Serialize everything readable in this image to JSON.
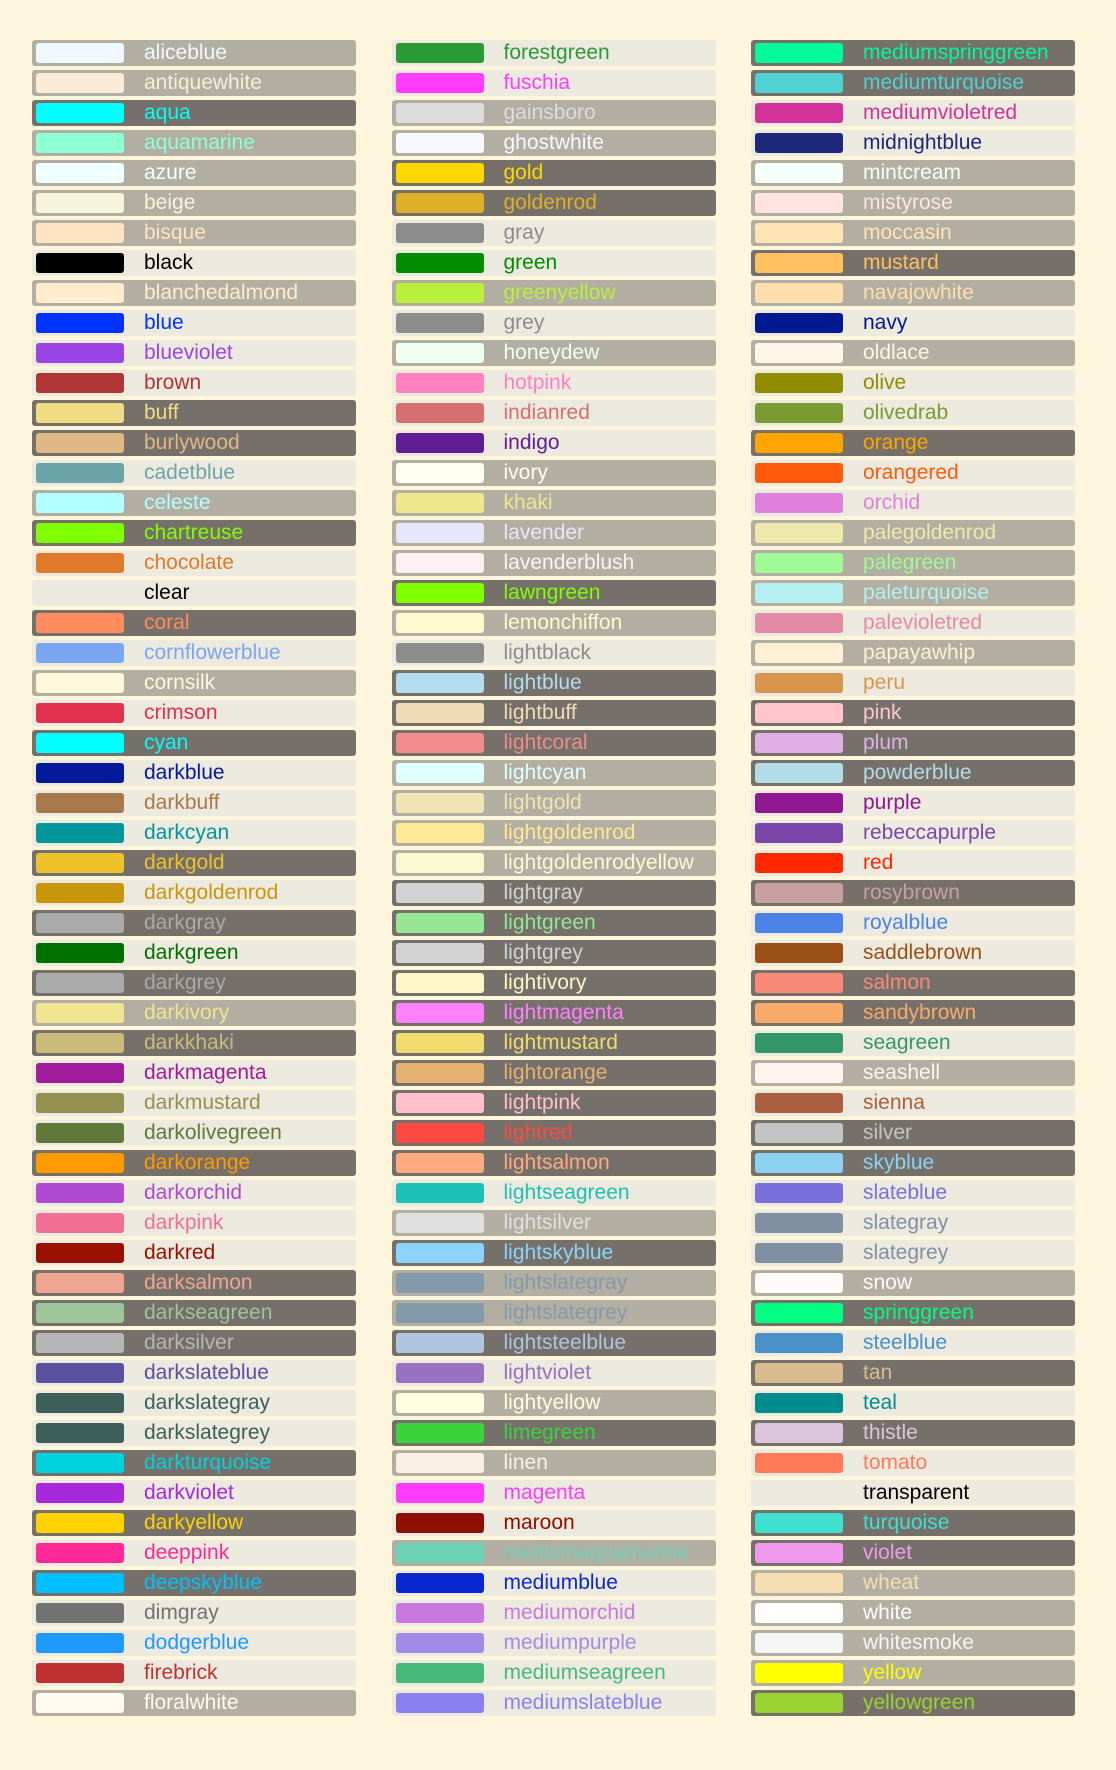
{
  "colors": [
    [
      {
        "name": "aliceblue",
        "hex": "#f0f8ff",
        "bg": "m"
      },
      {
        "name": "antiquewhite",
        "hex": "#faebd7",
        "bg": "m"
      },
      {
        "name": "aqua",
        "hex": "#00ffff",
        "bg": "d"
      },
      {
        "name": "aquamarine",
        "hex": "#8fffd4",
        "bg": "m"
      },
      {
        "name": "azure",
        "hex": "#f0ffff",
        "bg": "m"
      },
      {
        "name": "beige",
        "hex": "#f5f5dc",
        "bg": "m"
      },
      {
        "name": "bisque",
        "hex": "#ffe4c4",
        "bg": "m"
      },
      {
        "name": "black",
        "hex": "#000000",
        "bg": "l"
      },
      {
        "name": "blanchedalmond",
        "hex": "#ffebcd",
        "bg": "m"
      },
      {
        "name": "blue",
        "hex": "#0033ff",
        "bg": "l"
      },
      {
        "name": "blueviolet",
        "hex": "#9a45e6",
        "bg": "l"
      },
      {
        "name": "brown",
        "hex": "#b03535",
        "bg": "l"
      },
      {
        "name": "buff",
        "hex": "#f0dc82",
        "bg": "d"
      },
      {
        "name": "burlywood",
        "hex": "#deb887",
        "bg": "d"
      },
      {
        "name": "cadetblue",
        "hex": "#6ba5aa",
        "bg": "l"
      },
      {
        "name": "celeste",
        "hex": "#b2ffff",
        "bg": "m"
      },
      {
        "name": "chartreuse",
        "hex": "#80ff00",
        "bg": "d"
      },
      {
        "name": "chocolate",
        "hex": "#df7a2a",
        "bg": "l"
      },
      {
        "name": "clear",
        "hex": "transparent",
        "bg": "l",
        "text": "#000000"
      },
      {
        "name": "coral",
        "hex": "#ff8c5e",
        "bg": "d"
      },
      {
        "name": "cornflowerblue",
        "hex": "#7aa5f0",
        "bg": "l"
      },
      {
        "name": "cornsilk",
        "hex": "#fff8dc",
        "bg": "m"
      },
      {
        "name": "crimson",
        "hex": "#e2304f",
        "bg": "l"
      },
      {
        "name": "cyan",
        "hex": "#00ffff",
        "bg": "d"
      },
      {
        "name": "darkblue",
        "hex": "#041a9a",
        "bg": "l"
      },
      {
        "name": "darkbuff",
        "hex": "#a6784a",
        "bg": "l"
      },
      {
        "name": "darkcyan",
        "hex": "#00969a",
        "bg": "l"
      },
      {
        "name": "darkgold",
        "hex": "#eec22a",
        "bg": "d"
      },
      {
        "name": "darkgoldenrod",
        "hex": "#c8960a",
        "bg": "l"
      },
      {
        "name": "darkgray",
        "hex": "#aaaaaa",
        "bg": "d"
      },
      {
        "name": "darkgreen",
        "hex": "#007000",
        "bg": "l"
      },
      {
        "name": "darkgrey",
        "hex": "#aaaaaa",
        "bg": "d"
      },
      {
        "name": "darkivory",
        "hex": "#f0e490",
        "bg": "m"
      },
      {
        "name": "darkkhaki",
        "hex": "#c9bc7a",
        "bg": "d"
      },
      {
        "name": "darkmagenta",
        "hex": "#a01c9a",
        "bg": "l"
      },
      {
        "name": "darkmustard",
        "hex": "#939050",
        "bg": "l"
      },
      {
        "name": "darkolivegreen",
        "hex": "#60793a",
        "bg": "l"
      },
      {
        "name": "darkorange",
        "hex": "#ff9a00",
        "bg": "d"
      },
      {
        "name": "darkorchid",
        "hex": "#b04ad3",
        "bg": "l"
      },
      {
        "name": "darkpink",
        "hex": "#f07096",
        "bg": "l"
      },
      {
        "name": "darkred",
        "hex": "#9a1000",
        "bg": "l"
      },
      {
        "name": "darksalmon",
        "hex": "#eea690",
        "bg": "d"
      },
      {
        "name": "darkseagreen",
        "hex": "#9ec49a",
        "bg": "d"
      },
      {
        "name": "darksilver",
        "hex": "#b6b6b6",
        "bg": "d"
      },
      {
        "name": "darkslateblue",
        "hex": "#5a52a0",
        "bg": "l"
      },
      {
        "name": "darkslategray",
        "hex": "#3c5f5a",
        "bg": "l"
      },
      {
        "name": "darkslategrey",
        "hex": "#3c5f5a",
        "bg": "l"
      },
      {
        "name": "darkturquoise",
        "hex": "#00d2de",
        "bg": "d"
      },
      {
        "name": "darkviolet",
        "hex": "#a828dc",
        "bg": "l"
      },
      {
        "name": "darkyellow",
        "hex": "#ffd200",
        "bg": "d"
      },
      {
        "name": "deeppink",
        "hex": "#ff2896",
        "bg": "l"
      },
      {
        "name": "deepskyblue",
        "hex": "#00c0ff",
        "bg": "d"
      },
      {
        "name": "dimgray",
        "hex": "#727272",
        "bg": "l"
      },
      {
        "name": "dodgerblue",
        "hex": "#1e9aff",
        "bg": "l"
      },
      {
        "name": "firebrick",
        "hex": "#c03232",
        "bg": "l"
      },
      {
        "name": "floralwhite",
        "hex": "#fffaf0",
        "bg": "m"
      }
    ],
    [
      {
        "name": "forestgreen",
        "hex": "#2a9a36",
        "bg": "l"
      },
      {
        "name": "fuschia",
        "hex": "#ff3cff",
        "bg": "l"
      },
      {
        "name": "gainsboro",
        "hex": "#dcdcdc",
        "bg": "m"
      },
      {
        "name": "ghostwhite",
        "hex": "#f8f8ff",
        "bg": "m"
      },
      {
        "name": "gold",
        "hex": "#ffd700",
        "bg": "d"
      },
      {
        "name": "goldenrod",
        "hex": "#deb02a",
        "bg": "d"
      },
      {
        "name": "gray",
        "hex": "#8c8c8c",
        "bg": "l"
      },
      {
        "name": "green",
        "hex": "#008c00",
        "bg": "l"
      },
      {
        "name": "greenyellow",
        "hex": "#b8f03c",
        "bg": "m"
      },
      {
        "name": "grey",
        "hex": "#8c8c8c",
        "bg": "l"
      },
      {
        "name": "honeydew",
        "hex": "#f0fff0",
        "bg": "m"
      },
      {
        "name": "hotpink",
        "hex": "#ff80c0",
        "bg": "l"
      },
      {
        "name": "indianred",
        "hex": "#d67070",
        "bg": "l"
      },
      {
        "name": "indigo",
        "hex": "#601e96",
        "bg": "l"
      },
      {
        "name": "ivory",
        "hex": "#fffff0",
        "bg": "m"
      },
      {
        "name": "khaki",
        "hex": "#f0e68c",
        "bg": "m"
      },
      {
        "name": "lavender",
        "hex": "#e6e6fa",
        "bg": "m"
      },
      {
        "name": "lavenderblush",
        "hex": "#fff0f5",
        "bg": "m"
      },
      {
        "name": "lawngreen",
        "hex": "#80ff00",
        "bg": "d"
      },
      {
        "name": "lemonchiffon",
        "hex": "#fffacd",
        "bg": "m"
      },
      {
        "name": "lightblack",
        "hex": "#8c8c8c",
        "bg": "l"
      },
      {
        "name": "lightblue",
        "hex": "#b4dcee",
        "bg": "d"
      },
      {
        "name": "lightbuff",
        "hex": "#efdcb4",
        "bg": "d"
      },
      {
        "name": "lightcoral",
        "hex": "#f08c8c",
        "bg": "d"
      },
      {
        "name": "lightcyan",
        "hex": "#e0ffff",
        "bg": "m"
      },
      {
        "name": "lightgold",
        "hex": "#f0e4b4",
        "bg": "m"
      },
      {
        "name": "lightgoldenrod",
        "hex": "#ffe896",
        "bg": "m"
      },
      {
        "name": "lightgoldenrodyellow",
        "hex": "#fafad2",
        "bg": "m"
      },
      {
        "name": "lightgray",
        "hex": "#d2d2d2",
        "bg": "d"
      },
      {
        "name": "lightgreen",
        "hex": "#96e696",
        "bg": "d"
      },
      {
        "name": "lightgrey",
        "hex": "#d2d2d2",
        "bg": "d"
      },
      {
        "name": "lightivory",
        "hex": "#fff6c8",
        "bg": "d"
      },
      {
        "name": "lightmagenta",
        "hex": "#ff80ff",
        "bg": "d"
      },
      {
        "name": "lightmustard",
        "hex": "#f0dc6e",
        "bg": "d"
      },
      {
        "name": "lightorange",
        "hex": "#e6b070",
        "bg": "d"
      },
      {
        "name": "lightpink",
        "hex": "#ffc0cb",
        "bg": "d"
      },
      {
        "name": "lightred",
        "hex": "#ff4a44",
        "bg": "d"
      },
      {
        "name": "lightsalmon",
        "hex": "#ffaa80",
        "bg": "d"
      },
      {
        "name": "lightseagreen",
        "hex": "#1ec0b6",
        "bg": "l"
      },
      {
        "name": "lightsilver",
        "hex": "#e0e0e0",
        "bg": "m"
      },
      {
        "name": "lightskyblue",
        "hex": "#8cd2fa",
        "bg": "d"
      },
      {
        "name": "lightslategray",
        "hex": "#8499aa",
        "bg": "m"
      },
      {
        "name": "lightslategrey",
        "hex": "#8499aa",
        "bg": "m"
      },
      {
        "name": "lightsteelblue",
        "hex": "#b0c4de",
        "bg": "d"
      },
      {
        "name": "lightviolet",
        "hex": "#9a70c0",
        "bg": "l"
      },
      {
        "name": "lightyellow",
        "hex": "#ffffe0",
        "bg": "m"
      },
      {
        "name": "limegreen",
        "hex": "#3cd23c",
        "bg": "d"
      },
      {
        "name": "linen",
        "hex": "#faf0e6",
        "bg": "m"
      },
      {
        "name": "magenta",
        "hex": "#ff3cff",
        "bg": "l"
      },
      {
        "name": "maroon",
        "hex": "#8c1000",
        "bg": "l"
      },
      {
        "name": "mediumaquamarine",
        "hex": "#6ed2b4",
        "bg": "m"
      },
      {
        "name": "mediumblue",
        "hex": "#0a28d2",
        "bg": "l"
      },
      {
        "name": "mediumorchid",
        "hex": "#c878de",
        "bg": "l"
      },
      {
        "name": "mediumpurple",
        "hex": "#a08ce6",
        "bg": "l"
      },
      {
        "name": "mediumseagreen",
        "hex": "#46b878",
        "bg": "l"
      },
      {
        "name": "mediumslateblue",
        "hex": "#8a80f0",
        "bg": "l"
      }
    ],
    [
      {
        "name": "mediumspringgreen",
        "hex": "#00fa9a",
        "bg": "d"
      },
      {
        "name": "mediumturquoise",
        "hex": "#50d2d2",
        "bg": "d"
      },
      {
        "name": "mediumvioletred",
        "hex": "#d2329a",
        "bg": "l"
      },
      {
        "name": "midnightblue",
        "hex": "#1e2878",
        "bg": "l"
      },
      {
        "name": "mintcream",
        "hex": "#f5fffa",
        "bg": "m"
      },
      {
        "name": "mistyrose",
        "hex": "#ffe4e1",
        "bg": "m"
      },
      {
        "name": "moccasin",
        "hex": "#ffe4b5",
        "bg": "m"
      },
      {
        "name": "mustard",
        "hex": "#ffc060",
        "bg": "d"
      },
      {
        "name": "navajowhite",
        "hex": "#ffdead",
        "bg": "m"
      },
      {
        "name": "navy",
        "hex": "#001890",
        "bg": "l"
      },
      {
        "name": "oldlace",
        "hex": "#fdf5e6",
        "bg": "m"
      },
      {
        "name": "olive",
        "hex": "#908c00",
        "bg": "l"
      },
      {
        "name": "olivedrab",
        "hex": "#7a9a32",
        "bg": "l"
      },
      {
        "name": "orange",
        "hex": "#ffa500",
        "bg": "d"
      },
      {
        "name": "orangered",
        "hex": "#ff5a0a",
        "bg": "l"
      },
      {
        "name": "orchid",
        "hex": "#e080dc",
        "bg": "l"
      },
      {
        "name": "palegoldenrod",
        "hex": "#eee8aa",
        "bg": "m"
      },
      {
        "name": "palegreen",
        "hex": "#a0fa98",
        "bg": "m"
      },
      {
        "name": "paleturquoise",
        "hex": "#b4f0f0",
        "bg": "m"
      },
      {
        "name": "palevioletred",
        "hex": "#e28aa6",
        "bg": "l"
      },
      {
        "name": "papayawhip",
        "hex": "#ffefd5",
        "bg": "m"
      },
      {
        "name": "peru",
        "hex": "#d8964c",
        "bg": "l"
      },
      {
        "name": "pink",
        "hex": "#ffc4cc",
        "bg": "d"
      },
      {
        "name": "plum",
        "hex": "#e0b0e4",
        "bg": "d"
      },
      {
        "name": "powderblue",
        "hex": "#b4dce6",
        "bg": "d"
      },
      {
        "name": "purple",
        "hex": "#901890",
        "bg": "l"
      },
      {
        "name": "rebeccapurple",
        "hex": "#7a46aa",
        "bg": "l"
      },
      {
        "name": "red",
        "hex": "#ff2800",
        "bg": "l"
      },
      {
        "name": "rosybrown",
        "hex": "#c8a0a0",
        "bg": "d"
      },
      {
        "name": "royalblue",
        "hex": "#4a82e6",
        "bg": "l"
      },
      {
        "name": "saddlebrown",
        "hex": "#9a5014",
        "bg": "l"
      },
      {
        "name": "salmon",
        "hex": "#fa8a78",
        "bg": "d"
      },
      {
        "name": "sandybrown",
        "hex": "#f8aa6a",
        "bg": "d"
      },
      {
        "name": "seagreen",
        "hex": "#32966a",
        "bg": "l"
      },
      {
        "name": "seashell",
        "hex": "#fff5ee",
        "bg": "m"
      },
      {
        "name": "sienna",
        "hex": "#aa6040",
        "bg": "l"
      },
      {
        "name": "silver",
        "hex": "#c4c4c4",
        "bg": "d"
      },
      {
        "name": "skyblue",
        "hex": "#8cd2f0",
        "bg": "d"
      },
      {
        "name": "slateblue",
        "hex": "#7a70dc",
        "bg": "l"
      },
      {
        "name": "slategray",
        "hex": "#8090a2",
        "bg": "l"
      },
      {
        "name": "slategrey",
        "hex": "#8090a2",
        "bg": "l"
      },
      {
        "name": "snow",
        "hex": "#fffafa",
        "bg": "m"
      },
      {
        "name": "springgreen",
        "hex": "#00ff80",
        "bg": "d"
      },
      {
        "name": "steelblue",
        "hex": "#4a90c8",
        "bg": "l"
      },
      {
        "name": "tan",
        "hex": "#d8bc90",
        "bg": "d"
      },
      {
        "name": "teal",
        "hex": "#008c8c",
        "bg": "l"
      },
      {
        "name": "thistle",
        "hex": "#dcc4dc",
        "bg": "d"
      },
      {
        "name": "tomato",
        "hex": "#ff7a56",
        "bg": "l"
      },
      {
        "name": "transparent",
        "hex": "transparent",
        "bg": "l",
        "text": "#000000"
      },
      {
        "name": "turquoise",
        "hex": "#40e0d0",
        "bg": "d"
      },
      {
        "name": "violet",
        "hex": "#f09aee",
        "bg": "d"
      },
      {
        "name": "wheat",
        "hex": "#f5deb3",
        "bg": "m"
      },
      {
        "name": "white",
        "hex": "#ffffff",
        "bg": "m"
      },
      {
        "name": "whitesmoke",
        "hex": "#f5f5f5",
        "bg": "m"
      },
      {
        "name": "yellow",
        "hex": "#ffff00",
        "bg": "m"
      },
      {
        "name": "yellowgreen",
        "hex": "#9ad232",
        "bg": "d"
      }
    ]
  ]
}
